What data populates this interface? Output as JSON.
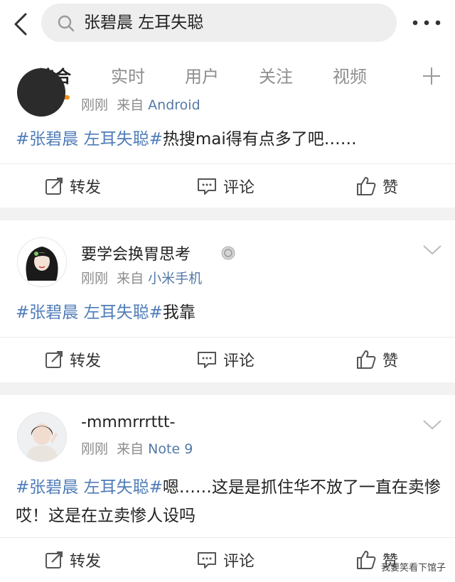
{
  "search": {
    "query": "张碧晨 左耳失聪"
  },
  "tabs": [
    "综合",
    "实时",
    "用户",
    "关注",
    "视频"
  ],
  "actions": {
    "repost": "转发",
    "comment": "评论",
    "like": "赞"
  },
  "posts": [
    {
      "meta_time": "刚刚",
      "meta_from": "来自",
      "meta_source": "Android",
      "hashtag": "#张碧晨 左耳失聪#",
      "text": "热搜mai得有点多了吧……"
    },
    {
      "author": "要学会换胃思考",
      "meta_time": "刚刚",
      "meta_from": "来自",
      "meta_source": "小米手机",
      "hashtag": "#张碧晨 左耳失聪#",
      "text": "我靠"
    },
    {
      "author": "-mmmrrrttt-",
      "meta_time": "刚刚",
      "meta_from": "来自",
      "meta_source": "Note 9",
      "hashtag": "#张碧晨 左耳失聪#",
      "text": "嗯……这是是抓住华不放了一直在卖惨哎！这是在立卖惨人设吗"
    }
  ],
  "watermark": "我要笑看下馆子",
  "colors": {
    "accent": "#f3901a",
    "link": "#4f7cb8",
    "source": "#5379a7"
  }
}
